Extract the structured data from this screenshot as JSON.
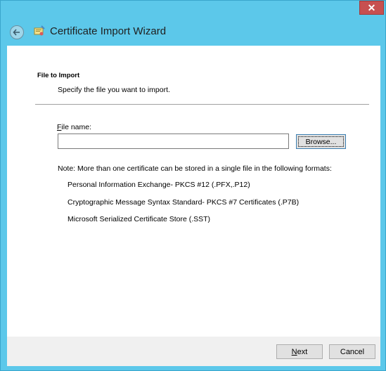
{
  "window": {
    "close_glyph": "✕"
  },
  "header": {
    "title": "Certificate Import Wizard",
    "back_icon": "back-arrow-icon",
    "app_icon": "certificate-wizard-icon"
  },
  "section": {
    "title": "File to Import",
    "subtitle": "Specify the file you want to import."
  },
  "file": {
    "label_prefix": "F",
    "label_rest": "ile name:",
    "value": "",
    "browse_label": "Browse..."
  },
  "note": "Note:  More than one certificate can be stored in a single file in the following formats:",
  "formats": [
    "Personal Information Exchange- PKCS #12 (.PFX,.P12)",
    "Cryptographic Message Syntax Standard- PKCS #7 Certificates (.P7B)",
    "Microsoft Serialized Certificate Store (.SST)"
  ],
  "footer": {
    "next_prefix": "N",
    "next_rest": "ext",
    "cancel_label": "Cancel"
  }
}
